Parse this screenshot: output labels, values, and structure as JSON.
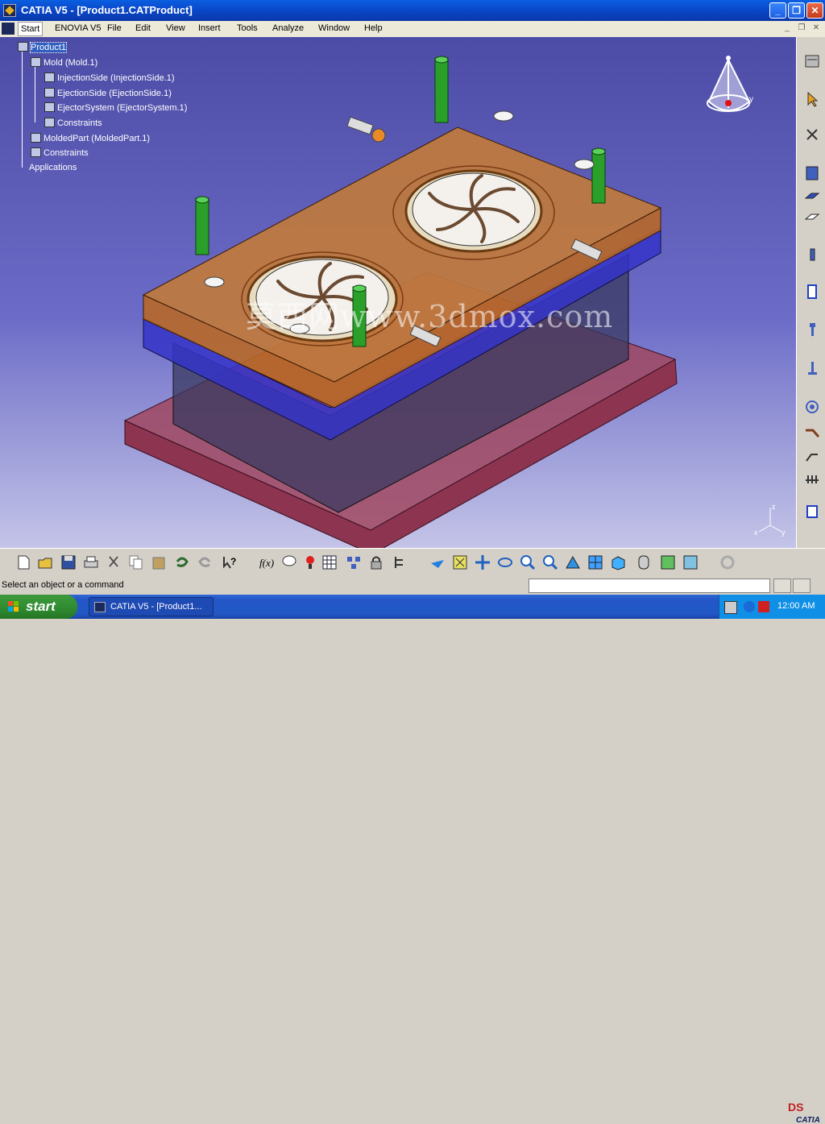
{
  "window": {
    "title": "CATIA V5 - [Product1.CATProduct]",
    "minimize": "_",
    "restore": "❐",
    "close": "✕"
  },
  "menu": {
    "items": [
      "Start",
      "ENOVIA V5",
      "File",
      "Edit",
      "View",
      "Insert",
      "Tools",
      "Analyze",
      "Window",
      "Help"
    ]
  },
  "tree": {
    "nodes": [
      {
        "label": "Product1",
        "icon": "product-icon",
        "selected": true
      },
      {
        "label": "Mold (Mold.1)",
        "icon": "mold-icon"
      },
      {
        "label": "InjectionSide (InjectionSide.1)",
        "icon": "component-icon"
      },
      {
        "label": "EjectionSide (EjectionSide.1)",
        "icon": "component-icon"
      },
      {
        "label": "EjectorSystem (EjectorSystem.1)",
        "icon": "component-icon"
      },
      {
        "label": "Constraints",
        "icon": "constraints-icon"
      },
      {
        "label": "MoldedPart (MoldedPart.1)",
        "icon": "part-icon"
      },
      {
        "label": "Constraints",
        "icon": "constraints-icon"
      },
      {
        "label": "Applications",
        "icon": "none"
      }
    ]
  },
  "viewport": {
    "watermark": "莫西网www.3dmox.com",
    "axis_labels": {
      "z": "z",
      "x": "x",
      "y": "y"
    },
    "compass_label": "y"
  },
  "status": {
    "message": "Select an object or a command",
    "command_input": ""
  },
  "taskbar": {
    "start_label": "start",
    "task_label": "CATIA V5 - [Product1...",
    "clock": "12:00 AM"
  },
  "colors": {
    "plate_orange": "#b8702a",
    "plate_blue": "#3c3cd0",
    "base_red": "#8c3450",
    "guide_pin_green": "#2aa02a"
  }
}
